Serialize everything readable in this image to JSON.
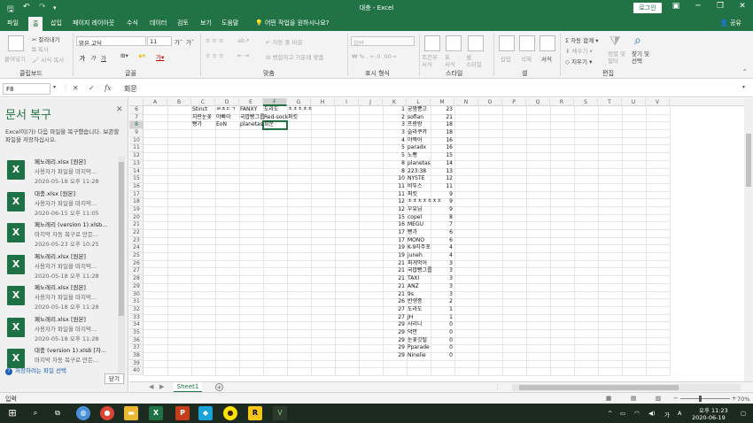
{
  "window": {
    "title": "대충 - Excel",
    "login_label": "로그인"
  },
  "quick_access": {
    "save": "🖫",
    "undo": "↶",
    "redo": "↷"
  },
  "window_controls": {
    "ribbon_options": "▣",
    "minimize": "─",
    "maximize": "❐",
    "close": "✕"
  },
  "tabs": [
    "파일",
    "홈",
    "삽입",
    "페이지 레이아웃",
    "수식",
    "데이터",
    "검토",
    "보기",
    "도움말"
  ],
  "active_tab": "홈",
  "tell_me": "어떤 작업을 원하시나요?",
  "share_label": "공유",
  "ribbon": {
    "clipboard": {
      "label": "클립보드",
      "paste": "붙여넣기",
      "cut": "잘라내기",
      "copy": "복사",
      "format_painter": "서식 복사"
    },
    "font": {
      "label": "글꼴",
      "name": "맑은 고딕",
      "size": "11",
      "bold": "가",
      "italic": "가",
      "underline": "가"
    },
    "alignment": {
      "label": "맞춤",
      "wrap": "자동 줄 바꿈",
      "merge": "병합하고 가운데 맞춤"
    },
    "number": {
      "label": "표시 형식",
      "format": "일반"
    },
    "styles": {
      "label": "스타일",
      "conditional": "조건부\n서식",
      "table": "표\n서식",
      "cell": "셀\n스타일"
    },
    "cells": {
      "label": "셀",
      "insert": "삽입",
      "delete": "삭제",
      "format": "서식"
    },
    "editing": {
      "label": "편집",
      "autosum": "자동 합계",
      "fill": "채우기",
      "clear": "지우기",
      "sort": "정렬 및\n필터",
      "find": "찾기 및\n선택"
    }
  },
  "formula_bar": {
    "name_box": "F8",
    "formula": "회문"
  },
  "recovery_pane": {
    "title": "문서 복구",
    "description": "Excel이(가) 다음 파일을 복구했습니다. 보관할 파일을 저장하십시오.",
    "files": [
      {
        "name": "페노레리.xlsx  [원본]",
        "desc": "사용자가 파일을 마지막...",
        "date": "2020-05-18 오후 11:28"
      },
      {
        "name": "대충.xlsx  [원본]",
        "desc": "사용자가 파일을 마지막...",
        "date": "2020-06-15 오후 11:05"
      },
      {
        "name": "페노레리 (version 1).xlsb...",
        "desc": "마지막 자동 복구로 만든...",
        "date": "2020-05-23 오후 10:25"
      },
      {
        "name": "페노레리.xlsx  [원본]",
        "desc": "사용자가 파일을 마지막...",
        "date": "2020-05-18 오후 11:28"
      },
      {
        "name": "페노레리.xlsx  [원본]",
        "desc": "사용자가 파일을 마지막...",
        "date": "2020-05-18 오후 11:28"
      },
      {
        "name": "페노레리.xlsx  [원본]",
        "desc": "사용자가 파일을 마지막...",
        "date": "2020-05-18 오후 11:28"
      },
      {
        "name": "대충 (version 1).xlsb  [자...",
        "desc": "마지막 자동 복구로 만든...",
        "date": ""
      }
    ],
    "link": "저장하려는 파일 선택",
    "close_button": "닫기"
  },
  "columns": [
    "A",
    "B",
    "C",
    "D",
    "E",
    "F",
    "G",
    "H",
    "I",
    "J",
    "K",
    "L",
    "M",
    "N",
    "O",
    "P",
    "Q",
    "R",
    "S",
    "T",
    "U",
    "V"
  ],
  "row_numbers": [
    6,
    7,
    8,
    9,
    10,
    11,
    12,
    13,
    14,
    15,
    16,
    17,
    18,
    19,
    20,
    21,
    22,
    23,
    24,
    25,
    26,
    27,
    28,
    29,
    30,
    31,
    32,
    33,
    34,
    35,
    36,
    37,
    38,
    39,
    40
  ],
  "left_table": [
    [
      "Stinct",
      "ㄹㅈㄷㄱ",
      "FANXY",
      "도라도",
      "ㅊㅊㅊㅊㅊ"
    ],
    [
      "자란눈꽃",
      "야빠이",
      "국밥빵그룹",
      "Red-sock",
      "퍼킷"
    ],
    [
      "빵가",
      "EoN",
      "planetas",
      "회문",
      ""
    ]
  ],
  "ranking": [
    [
      "1",
      "궁짬뽕고",
      "23"
    ],
    [
      "2",
      "soflan",
      "21"
    ],
    [
      "3",
      "프랑랑",
      "18"
    ],
    [
      "3",
      "슬라쿠카",
      "18"
    ],
    [
      "4",
      "야짝어",
      "16"
    ],
    [
      "5",
      "paradx",
      "16"
    ],
    [
      "5",
      "노빵",
      "15"
    ],
    [
      "8",
      "planetas",
      "14"
    ],
    [
      "8",
      "223:38",
      "13"
    ],
    [
      "10",
      "NYSTE",
      "12"
    ],
    [
      "11",
      "비뚜스",
      "11"
    ],
    [
      "11",
      "퍼킷",
      "9"
    ],
    [
      "12",
      "ㅊㅊㅊㅊㅊㅊㅊ",
      "9"
    ],
    [
      "12",
      "우유님",
      "9"
    ],
    [
      "15",
      "copel",
      "8"
    ],
    [
      "16",
      "MEGU",
      "7"
    ],
    [
      "17",
      "빵가",
      "6"
    ],
    [
      "17",
      "MONO",
      "6"
    ],
    [
      "19",
      "K-9자주포",
      "4"
    ],
    [
      "19",
      "juneh",
      "4"
    ],
    [
      "21",
      "퍼게먹어",
      "3"
    ],
    [
      "21",
      "국밥빵그룹",
      "3"
    ],
    [
      "21",
      "TAXI",
      "3"
    ],
    [
      "21",
      "ANZ",
      "3"
    ],
    [
      "21",
      "9s",
      "3"
    ],
    [
      "26",
      "반생종",
      "2"
    ],
    [
      "27",
      "도라도",
      "1"
    ],
    [
      "27",
      "JH",
      "1"
    ],
    [
      "29",
      "사리니",
      "0"
    ],
    [
      "29",
      "덕만",
      "0"
    ],
    [
      "29",
      "눈꽃깃털",
      "0"
    ],
    [
      "29",
      "Pparade",
      "0"
    ],
    [
      "29",
      "Ninelie",
      "0"
    ]
  ],
  "sheet_tab": "Sheet1",
  "status": {
    "text": "입력",
    "zoom": "70%"
  },
  "taskbar": {
    "time": "오후 11:23",
    "date": "2020-06-19"
  },
  "colors": {
    "excel_green": "#217346",
    "taskbar": "#1d2a20"
  }
}
